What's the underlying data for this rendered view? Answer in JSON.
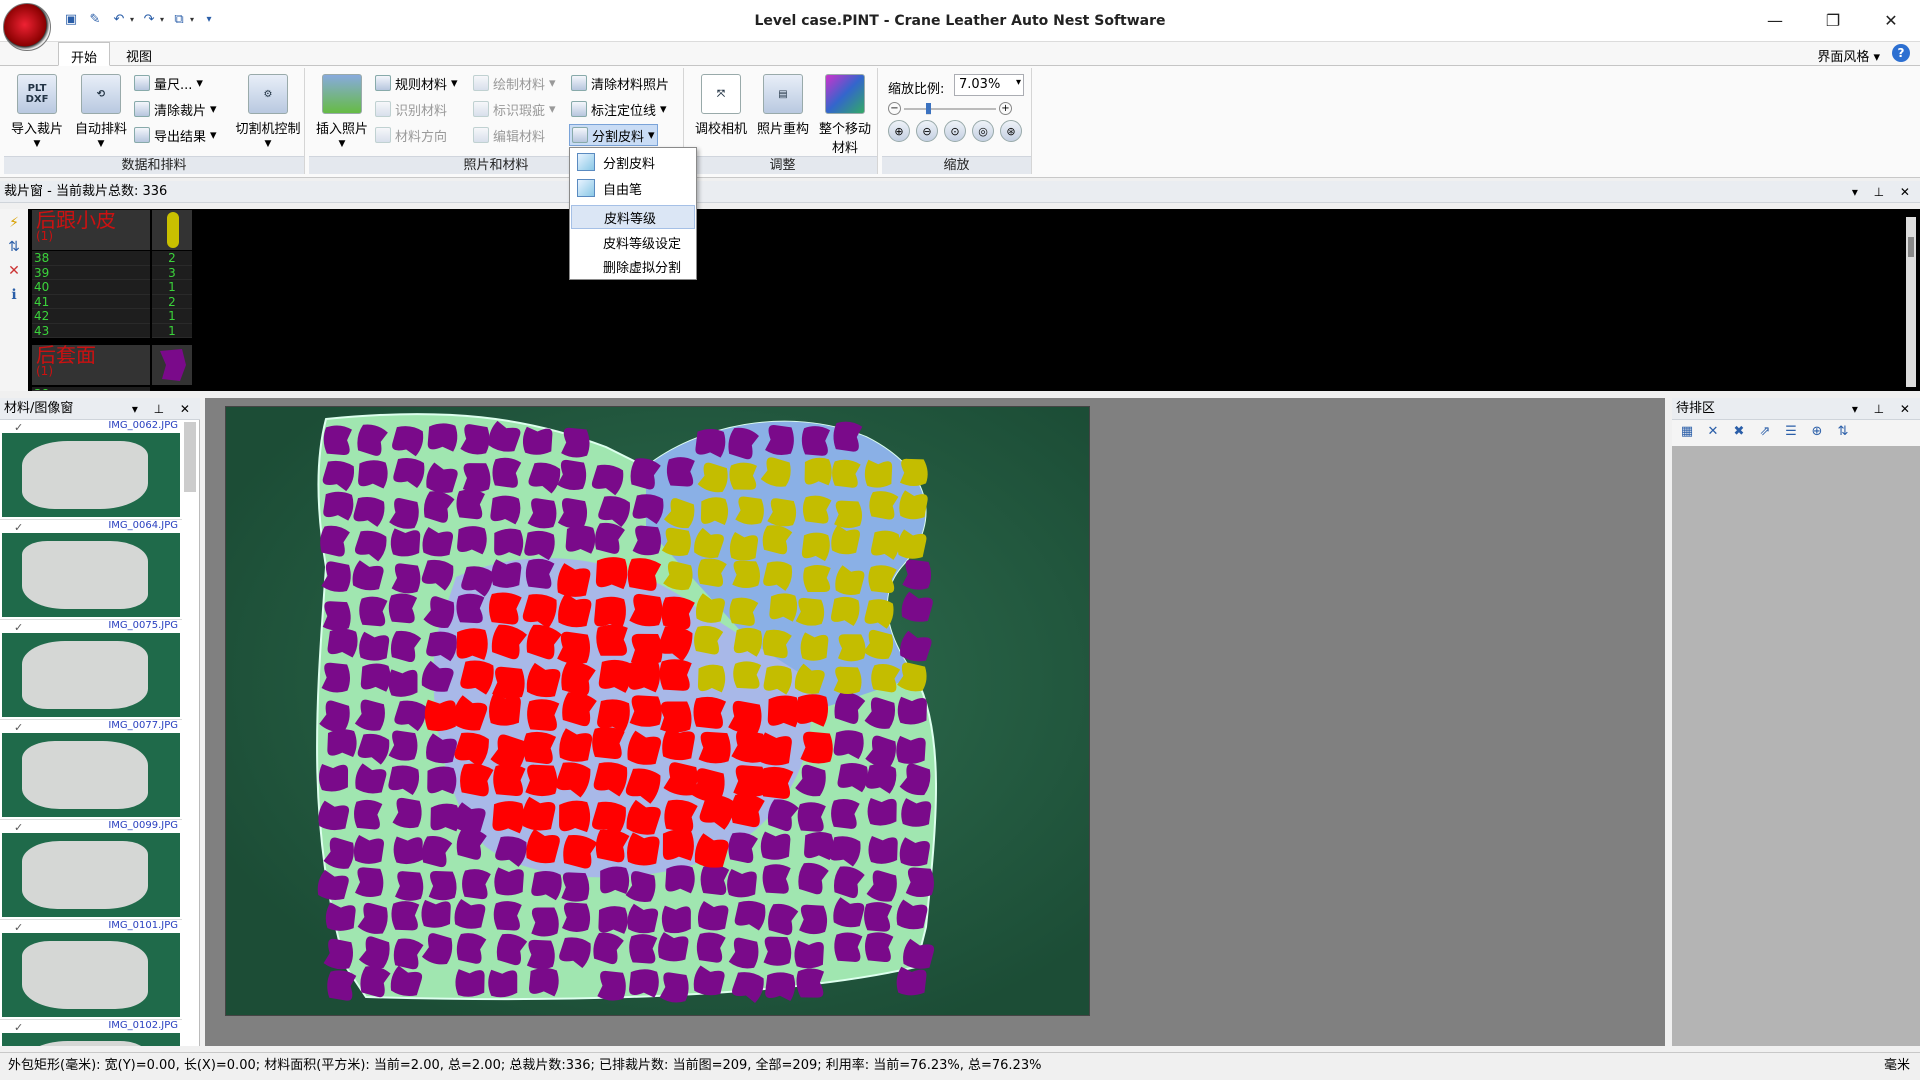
{
  "window": {
    "title": "Level case.PINT - Crane Leather Auto Nest Software",
    "minimize": "—",
    "maximize": "❐",
    "close": "✕"
  },
  "qat": {
    "icons": [
      "save-icon",
      "script-icon",
      "undo-icon",
      "redo-icon",
      "screenshot-icon",
      "customize-icon"
    ]
  },
  "tabs": [
    {
      "label": "开始",
      "active": true
    },
    {
      "label": "视图",
      "active": false
    }
  ],
  "ui_style": "界面风格",
  "help": "?",
  "ribbon": {
    "group1": {
      "label": "数据和排料",
      "import_cut": "导入裁片",
      "auto_nest": "自动排料",
      "measure": "量尺...",
      "clear_pieces": "清除裁片",
      "export_result": "导出结果",
      "cutter_control": "切割机控制",
      "plt_text": "PLT DXF"
    },
    "group2": {
      "label": "照片和材料",
      "insert_photo": "插入照片",
      "regular_material": "规则材料",
      "recognize_material": "识别材料",
      "material_direction": "材料方向",
      "draw_material": "绘制材料",
      "mark_defects": "标识瑕疵",
      "edit_material": "编辑材料",
      "clear_material_photo": "清除材料照片",
      "mark_position_line": "标注定位线",
      "split_leather": "分割皮料"
    },
    "group3": {
      "label": "调整",
      "calibrate_camera": "调校相机",
      "photo_reconstruct": "照片重构",
      "move_all_material": "整个移动材料"
    },
    "group4": {
      "label": "缩放",
      "zoom_label": "缩放比例:",
      "zoom_value": "7.03%"
    }
  },
  "dropdown": {
    "items": [
      "分割皮料",
      "自由笔",
      "皮料等级",
      "皮料等级设定",
      "删除虚拟分割"
    ],
    "highlighted": "皮料等级"
  },
  "pieces_panel": {
    "title": "裁片窗 - 当前裁片总数: 336",
    "pieces": [
      {
        "name": "后跟小皮",
        "qty": "(1)",
        "color": "#c9c000"
      },
      {
        "name": "后套面",
        "qty": "(1)",
        "color": "#7a0a8a"
      }
    ],
    "sizes": [
      "38",
      "39",
      "40",
      "41",
      "42",
      "43"
    ],
    "counts": [
      "2",
      "3",
      "1",
      "2",
      "1",
      "1"
    ],
    "next_size_partial": "38"
  },
  "material_panel": {
    "title": "材料/图像窗",
    "images": [
      "IMG_0062.JPG",
      "IMG_0064.JPG",
      "IMG_0075.JPG",
      "IMG_0077.JPG",
      "IMG_0099.JPG",
      "IMG_0101.JPG",
      "IMG_0102.JPG"
    ]
  },
  "pending_panel": {
    "title": "待排区"
  },
  "colors": {
    "purple_piece": "#7a0a8a",
    "yellow_piece": "#c4bd00",
    "red_piece": "#ff0000",
    "leather_light": "#a0e6b0",
    "leather_blue": "#8ab0e6",
    "board": "#215a40"
  },
  "status": {
    "text": "外包矩形(毫米): 宽(Y)=0.00, 长(X)=0.00; 材料面积(平方米): 当前=2.00, 总=2.00; 总裁片数:336; 已排裁片数: 当前图=209, 全部=209; 利用率: 当前=76.23%, 总=76.23%",
    "unit": "毫米"
  }
}
